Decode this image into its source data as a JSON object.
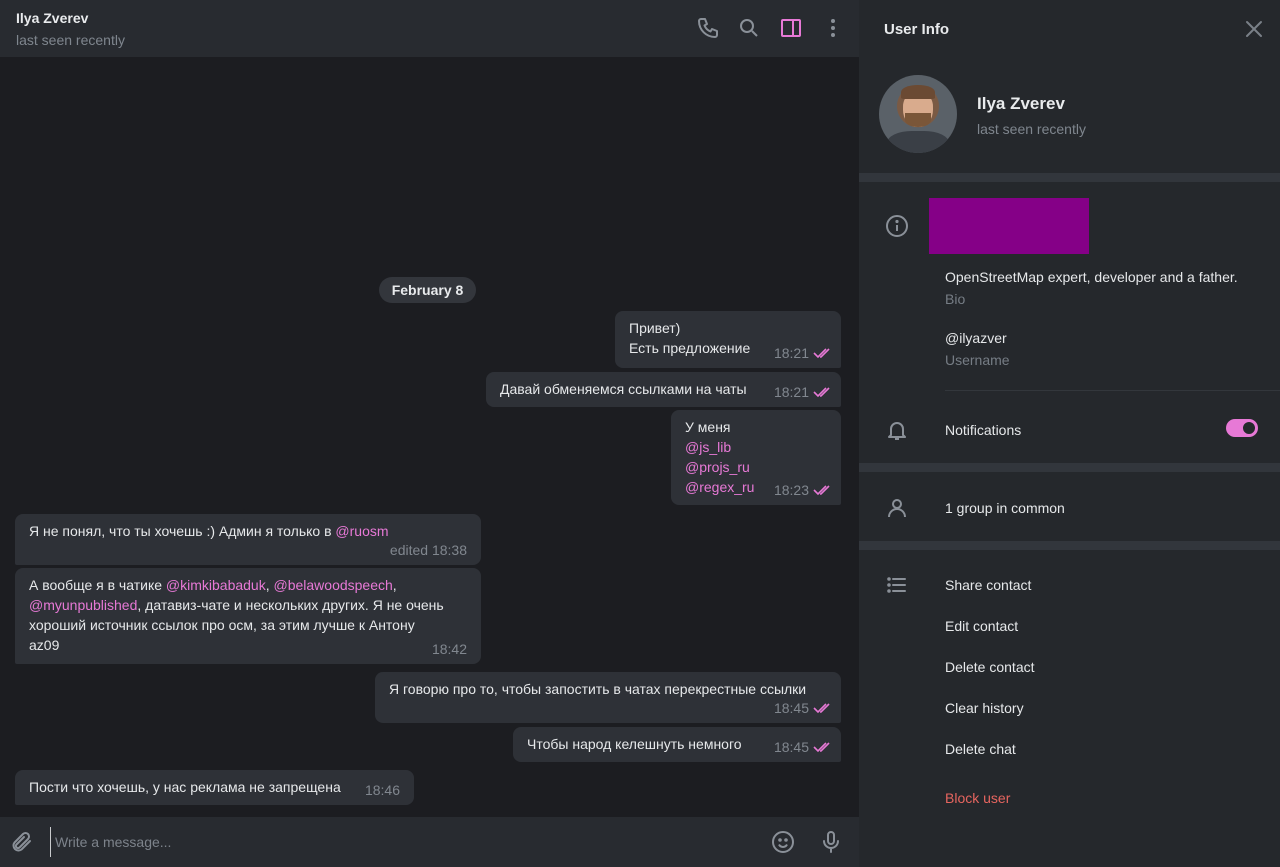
{
  "header": {
    "name": "Ilya Zverev",
    "status": "last seen recently",
    "icons": [
      "phone-icon",
      "search-icon",
      "sidebar-toggle-icon",
      "more-vertical-icon"
    ]
  },
  "date_separator": "February 8",
  "messages": [
    {
      "id": "m1",
      "dir": "out",
      "lines": [
        "Привет)",
        "Есть предложение"
      ],
      "time": "18:21",
      "read": true
    },
    {
      "id": "m2",
      "dir": "out",
      "lines": [
        "Давай обменяемся ссылками на чаты"
      ],
      "time": "18:21",
      "read": true
    },
    {
      "id": "m3",
      "dir": "out",
      "lines": [
        "У меня",
        "@js_lib",
        "@projs_ru",
        "@regex_ru"
      ],
      "time": "18:23",
      "read": true
    },
    {
      "id": "m4",
      "dir": "in",
      "text_before": "Я не понял, что ты хочешь :) Админ я только в ",
      "mention": "@ruosm",
      "time": "edited 18:38"
    },
    {
      "id": "m5",
      "dir": "in",
      "line1_before": "А вообще я в чатике ",
      "line1_m1": "@kimkibabaduk",
      "line1_sep": ", ",
      "line1_m2": "@belawoodspeech",
      "line1_after": ",",
      "line2_m": "@myunpublished",
      "line2_after": ", датавиз-чате и нескольких других. Я не очень",
      "line3": "хороший источник ссылок про осм, за этим лучше к Антону",
      "line4": "az09",
      "time": "18:42"
    },
    {
      "id": "m6",
      "dir": "out",
      "lines": [
        "Я говорю про то, чтобы запостить в чатах перекрестные ссылки"
      ],
      "time": "18:45",
      "read": true
    },
    {
      "id": "m7",
      "dir": "out",
      "lines": [
        "Чтобы народ келешнуть немного"
      ],
      "time": "18:45",
      "read": true
    },
    {
      "id": "m8",
      "dir": "in",
      "lines": [
        "Пости что хочешь, у нас реклама не запрещена"
      ],
      "time": "18:46"
    }
  ],
  "composer": {
    "placeholder": "Write a message...",
    "icons": [
      "paperclip-icon",
      "emoji-icon",
      "microphone-icon"
    ]
  },
  "info_panel": {
    "title": "User Info",
    "name": "Ilya Zverev",
    "status": "last seen recently",
    "bio": "OpenStreetMap expert, developer and a father.",
    "bio_label": "Bio",
    "username": "@ilyazver",
    "username_label": "Username",
    "notifications_label": "Notifications",
    "notifications_on": true,
    "groups_in_common": "1 group in common",
    "actions": [
      "Share contact",
      "Edit contact",
      "Delete contact",
      "Clear history",
      "Delete chat"
    ],
    "block_label": "Block user"
  },
  "colors": {
    "accent": "#e779d6",
    "danger": "#e6655f",
    "redacted": "#850087"
  }
}
